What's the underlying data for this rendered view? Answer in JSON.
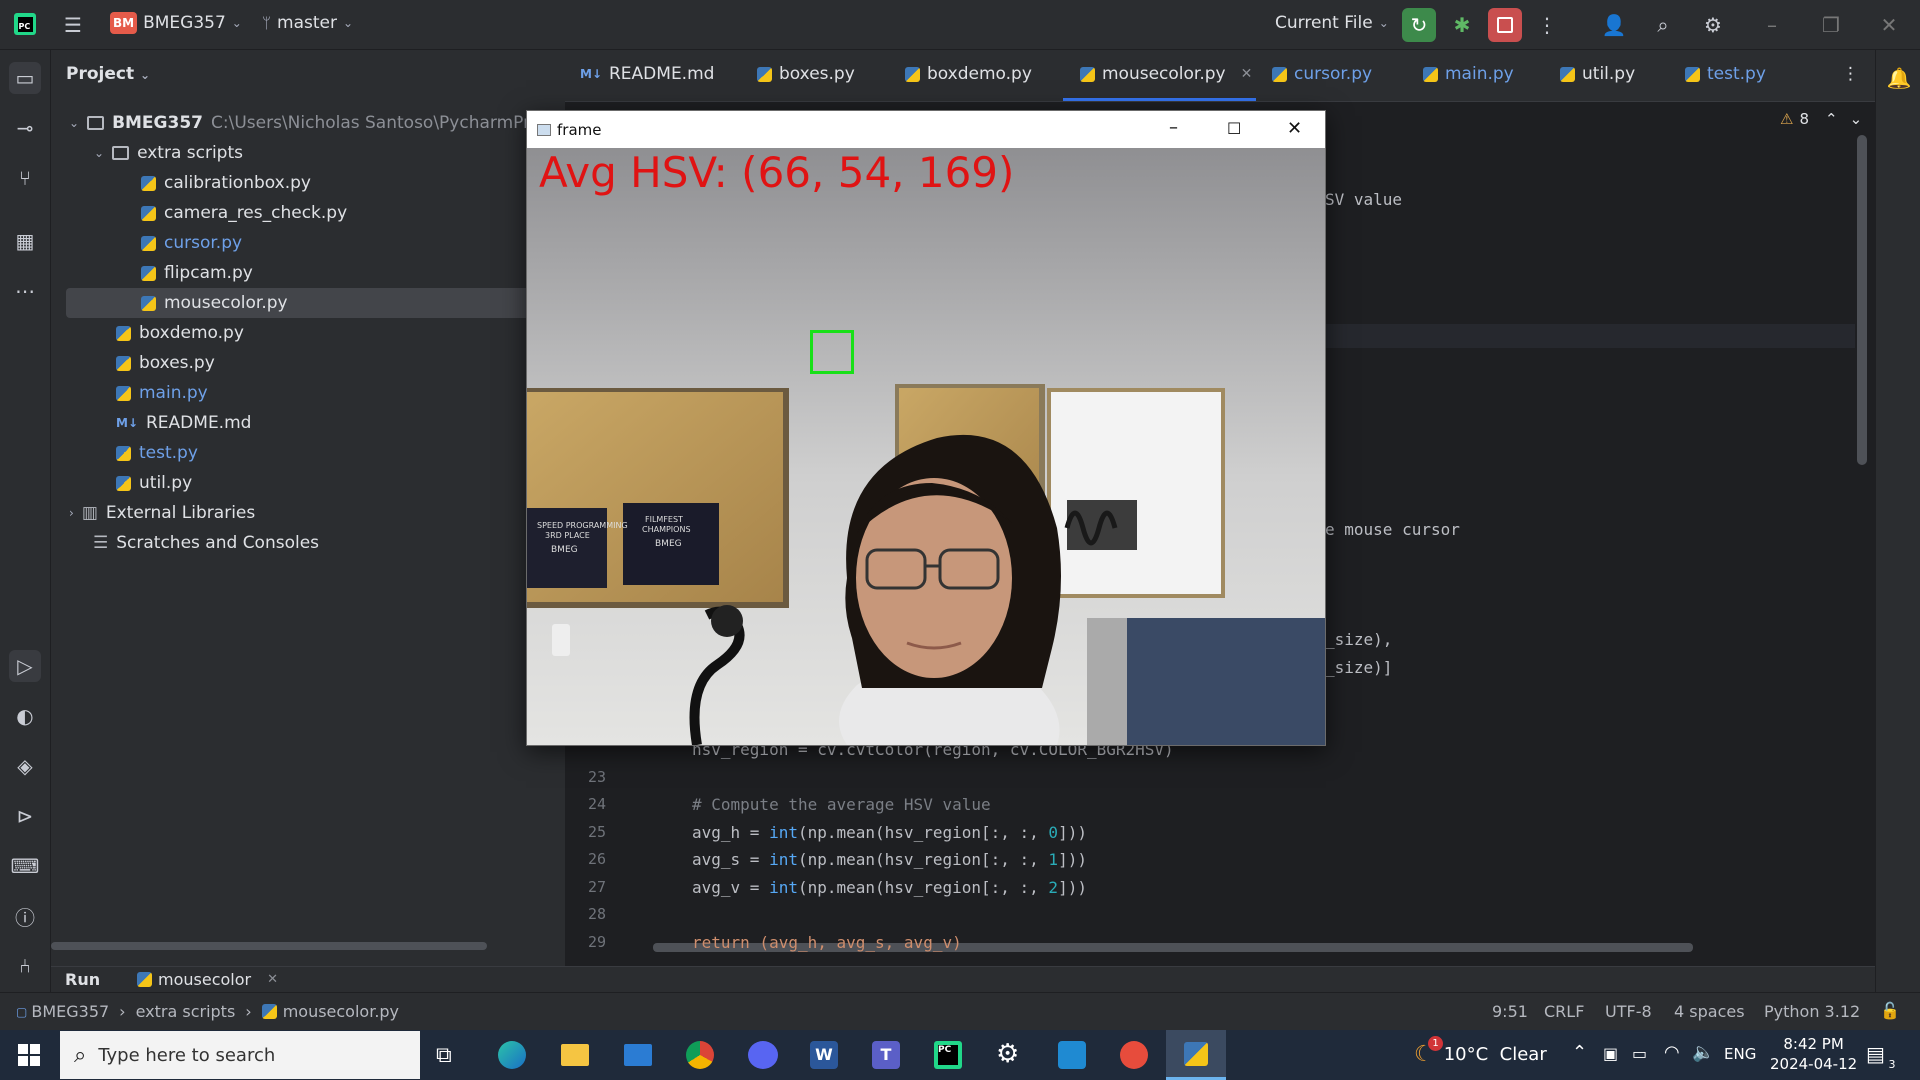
{
  "titlebar": {
    "project_badge": "BM",
    "project_name": "BMEG357",
    "branch": "master",
    "run_config": "Current File"
  },
  "project_panel": {
    "title": "Project",
    "root_name": "BMEG357",
    "root_path": "C:\\Users\\Nicholas Santoso\\PycharmProje",
    "folder_extra": "extra scripts",
    "extra_files": [
      "calibrationbox.py",
      "camera_res_check.py",
      "cursor.py",
      "flipcam.py",
      "mousecolor.py"
    ],
    "root_files": [
      "boxdemo.py",
      "boxes.py",
      "main.py",
      "README.md",
      "test.py",
      "util.py"
    ],
    "external_libraries": "External Libraries",
    "scratches": "Scratches and Consoles"
  },
  "editor_tabs": [
    {
      "label": "README.md",
      "color": "#dfe1e5"
    },
    {
      "label": "boxes.py",
      "color": "#dfe1e5"
    },
    {
      "label": "boxdemo.py",
      "color": "#dfe1e5"
    },
    {
      "label": "mousecolor.py",
      "color": "#dfe1e5"
    },
    {
      "label": "cursor.py",
      "color": "#6ea0e8"
    },
    {
      "label": "main.py",
      "color": "#6ea0e8"
    },
    {
      "label": "util.py",
      "color": "#dfe1e5"
    },
    {
      "label": "test.py",
      "color": "#6ea0e8"
    }
  ],
  "warnings_count": "8",
  "code_fragments": {
    "frag1": "SV value",
    "frag2": "e mouse cursor",
    "frag3": "_size),",
    "frag4": "_size)]",
    "line22": "hsv_region = cv.cvtColor(region, cv.COLOR_BGR2HSV)"
  },
  "code_lines": [
    {
      "num": "23",
      "text": ""
    },
    {
      "num": "24",
      "text": "# Compute the average HSV value"
    },
    {
      "num": "25",
      "text": "avg_h = int(np.mean(hsv_region[:, :, 0]))"
    },
    {
      "num": "26",
      "text": "avg_s = int(np.mean(hsv_region[:, :, 1]))"
    },
    {
      "num": "27",
      "text": "avg_v = int(np.mean(hsv_region[:, :, 2]))"
    },
    {
      "num": "28",
      "text": ""
    },
    {
      "num": "29",
      "text": "return (avg_h, avg_s, avg_v)"
    }
  ],
  "frame_window": {
    "title": "frame",
    "overlay_text": "Avg HSV: (66, 54, 169)",
    "poster1_line1": "SPEED PROGRAMMING",
    "poster1_line2": "3RD PLACE",
    "poster2_line1": "FILMFEST",
    "poster2_line2": "CHAMPIONS",
    "poster_logo": "BMEG"
  },
  "runbar": {
    "run_label": "Run",
    "run_tab": "mousecolor"
  },
  "statusbar": {
    "crumb1": "BMEG357",
    "crumb2": "extra scripts",
    "crumb3": "mousecolor.py",
    "position": "9:51",
    "line_sep": "CRLF",
    "encoding": "UTF-8",
    "indent": "4 spaces",
    "interpreter": "Python 3.12"
  },
  "taskbar": {
    "search_placeholder": "Type here to search",
    "weather": "10°C  Clear",
    "weather_badge": "1",
    "lang": "ENG",
    "time": "8:42 PM",
    "date": "2024-04-12",
    "notif_count": "3"
  }
}
